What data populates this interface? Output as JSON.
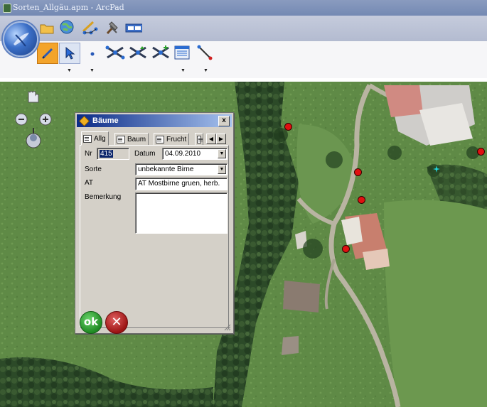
{
  "window": {
    "title": "Sorten_Allgäu.apm - ArcPad"
  },
  "toolbar": {
    "top_icons": [
      "folder-icon",
      "globe-icon",
      "edit-tools-icon",
      "hammer-icon",
      "scale-bar-icon"
    ],
    "bottom_icons": [
      "pencil-icon",
      "select-arrow-icon",
      "point-icon",
      "vertex-edit-icon",
      "move-vertex-icon",
      "add-vertex-icon",
      "attribute-table-icon",
      "line-tool-icon"
    ]
  },
  "dialog": {
    "title": "Bäume",
    "close_label": "x",
    "tabs": [
      {
        "label": "Allg",
        "active": true
      },
      {
        "label": "Baum",
        "active": false
      },
      {
        "label": "Frucht",
        "active": false
      }
    ],
    "fields": {
      "nr_label": "Nr",
      "nr_value": "415",
      "datum_label": "Datum",
      "datum_value": "04.09.2010",
      "sorte_label": "Sorte",
      "sorte_value": "unbekannte Birne",
      "at_label": "AT",
      "at_value": "AT Mostbirne gruen, herb.",
      "bemerkung_label": "Bemerkung",
      "bemerkung_value": ""
    },
    "ok_label": "ok",
    "cancel_label": "✕"
  },
  "map": {
    "point_color": "#e01010",
    "selected_point_color": "#22d8e0"
  },
  "colors": {
    "selected_tool": "#f3a42b",
    "title_bar": "#7e91b9"
  }
}
